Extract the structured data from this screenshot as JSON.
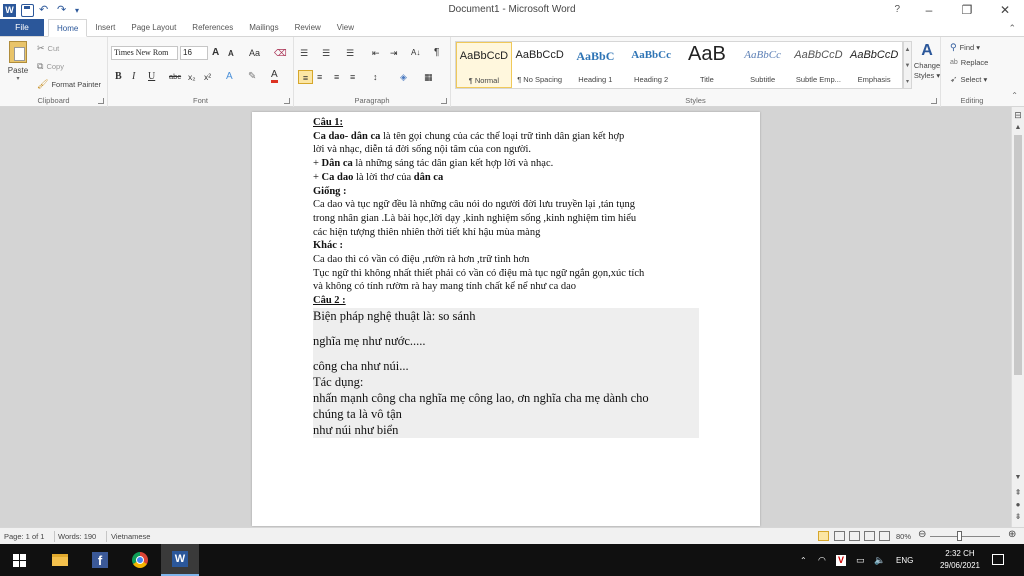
{
  "window": {
    "title": "Document1 - Microsoft Word",
    "controls": [
      "–",
      "❐",
      "✕"
    ],
    "help": "?"
  },
  "qat": {
    "logo": "W",
    "undo": "↶",
    "redo": "↷"
  },
  "tabs": {
    "file": "File",
    "items": [
      "Home",
      "Insert",
      "Page Layout",
      "References",
      "Mailings",
      "Review",
      "View"
    ],
    "active": "Home"
  },
  "ribbon": {
    "clipboard": {
      "paste": "Paste",
      "cut": "Cut",
      "copy": "Copy",
      "format_painter": "Format Painter",
      "label": "Clipboard"
    },
    "font": {
      "font_name": "Times New Rom",
      "font_size": "16",
      "grow": "A",
      "shrink": "A",
      "change_case": "Aa",
      "bold": "B",
      "italic": "I",
      "underline": "U",
      "strike": "abc",
      "subscript": "x₂",
      "superscript": "x²",
      "font_color": "A",
      "label": "Font"
    },
    "paragraph": {
      "label": "Paragraph",
      "sort": "A↓",
      "pilcrow": "¶"
    },
    "styles": {
      "items": [
        {
          "sample": "AaBbCcD",
          "name": "¶ Normal",
          "color": "#222222"
        },
        {
          "sample": "AaBbCcD",
          "name": "¶ No Spacing",
          "color": "#222222"
        },
        {
          "sample": "AaBbC",
          "name": "Heading 1",
          "color": "#2e74b5"
        },
        {
          "sample": "AaBbCc",
          "name": "Heading 2",
          "color": "#2e74b5"
        },
        {
          "sample": "AaB",
          "name": "Title",
          "color": "#222222"
        },
        {
          "sample": "AaBbCc",
          "name": "Subtitle",
          "color": "#5b7fb5"
        },
        {
          "sample": "AaBbCcD",
          "name": "Subtle Emp...",
          "color": "#555555"
        },
        {
          "sample": "AaBbCcD",
          "name": "Emphasis",
          "color": "#222222"
        }
      ],
      "change_styles": [
        "Change",
        "Styles ▾"
      ],
      "label": "Styles"
    },
    "editing": {
      "find": "Find ▾",
      "replace": "Replace",
      "select": "Select ▾",
      "label": "Editing"
    }
  },
  "document": {
    "lines": [
      [
        {
          "t": "Câu 1:",
          "s": "b u"
        }
      ],
      [
        {
          "t": "Ca dao- dân ca",
          "s": "b"
        },
        {
          "t": " là tên gọi chung của các thể loại trữ tình dân gian kết hợp",
          "s": ""
        }
      ],
      [
        {
          "t": "lời và nhạc, diễn tả đời sống nội tâm của con người.",
          "s": ""
        }
      ],
      [
        {
          "t": "+ ",
          "s": ""
        },
        {
          "t": "Dân ca",
          "s": "b"
        },
        {
          "t": " là những sáng tác dân gian kết hợp lời và nhạc.",
          "s": ""
        }
      ],
      [
        {
          "t": "+ ",
          "s": ""
        },
        {
          "t": "Ca dao",
          "s": "b"
        },
        {
          "t": " là lời thơ của ",
          "s": ""
        },
        {
          "t": "dân ca",
          "s": "b"
        }
      ],
      [
        {
          "t": "Giống :",
          "s": "b"
        }
      ],
      [
        {
          "t": "Ca dao và tục ngữ đều là những câu nói do người đời lưu truyền lại ,tán tụng",
          "s": ""
        }
      ],
      [
        {
          "t": "trong nhân gian .Là bài học,lời dạy ,kinh nghiệm sống ,kinh nghiệm tìm hiểu",
          "s": ""
        }
      ],
      [
        {
          "t": "các hiện tượng thiên nhiên thời tiết khí hậu mùa màng",
          "s": ""
        }
      ],
      [
        {
          "t": "Khác :",
          "s": "b"
        }
      ],
      [
        {
          "t": "Ca dao thì có vần có điệu ,rườn rà hơn ,trữ tình hơn",
          "s": ""
        }
      ],
      [
        {
          "t": "Tục ngữ thì không nhất thiết phải có vần có điệu mà tục ngữ ngắn gọn,xúc tích",
          "s": ""
        }
      ],
      [
        {
          "t": "và không có tính rườm rà hay mang tính chất kể nể như ca dao",
          "s": ""
        }
      ],
      [
        {
          "t": "Câu 2 :",
          "s": "b u"
        }
      ]
    ],
    "shaded_lines": [
      {
        "t": "Biện pháp nghệ thuật là: so sánh",
        "gap": false
      },
      {
        "t": "nghĩa mẹ như nước.....",
        "gap": true
      },
      {
        "t": "công cha như núi...",
        "gap": true
      },
      {
        "t": "Tác dụng:",
        "gap": false
      },
      {
        "t": "nhấn mạnh công cha nghĩa mẹ công lao, ơn nghĩa cha mẹ dành cho",
        "gap": false
      },
      {
        "t": "chúng ta là vô tận",
        "gap": false
      },
      {
        "t": "như núi như biển",
        "gap": false
      }
    ]
  },
  "status": {
    "page": "Page: 1 of 1",
    "words": "Words: 190",
    "language": "Vietnamese",
    "zoom": "80%"
  },
  "taskbar": {
    "lang": "ENG",
    "time": "2:32 CH",
    "date": "29/06/2021"
  }
}
